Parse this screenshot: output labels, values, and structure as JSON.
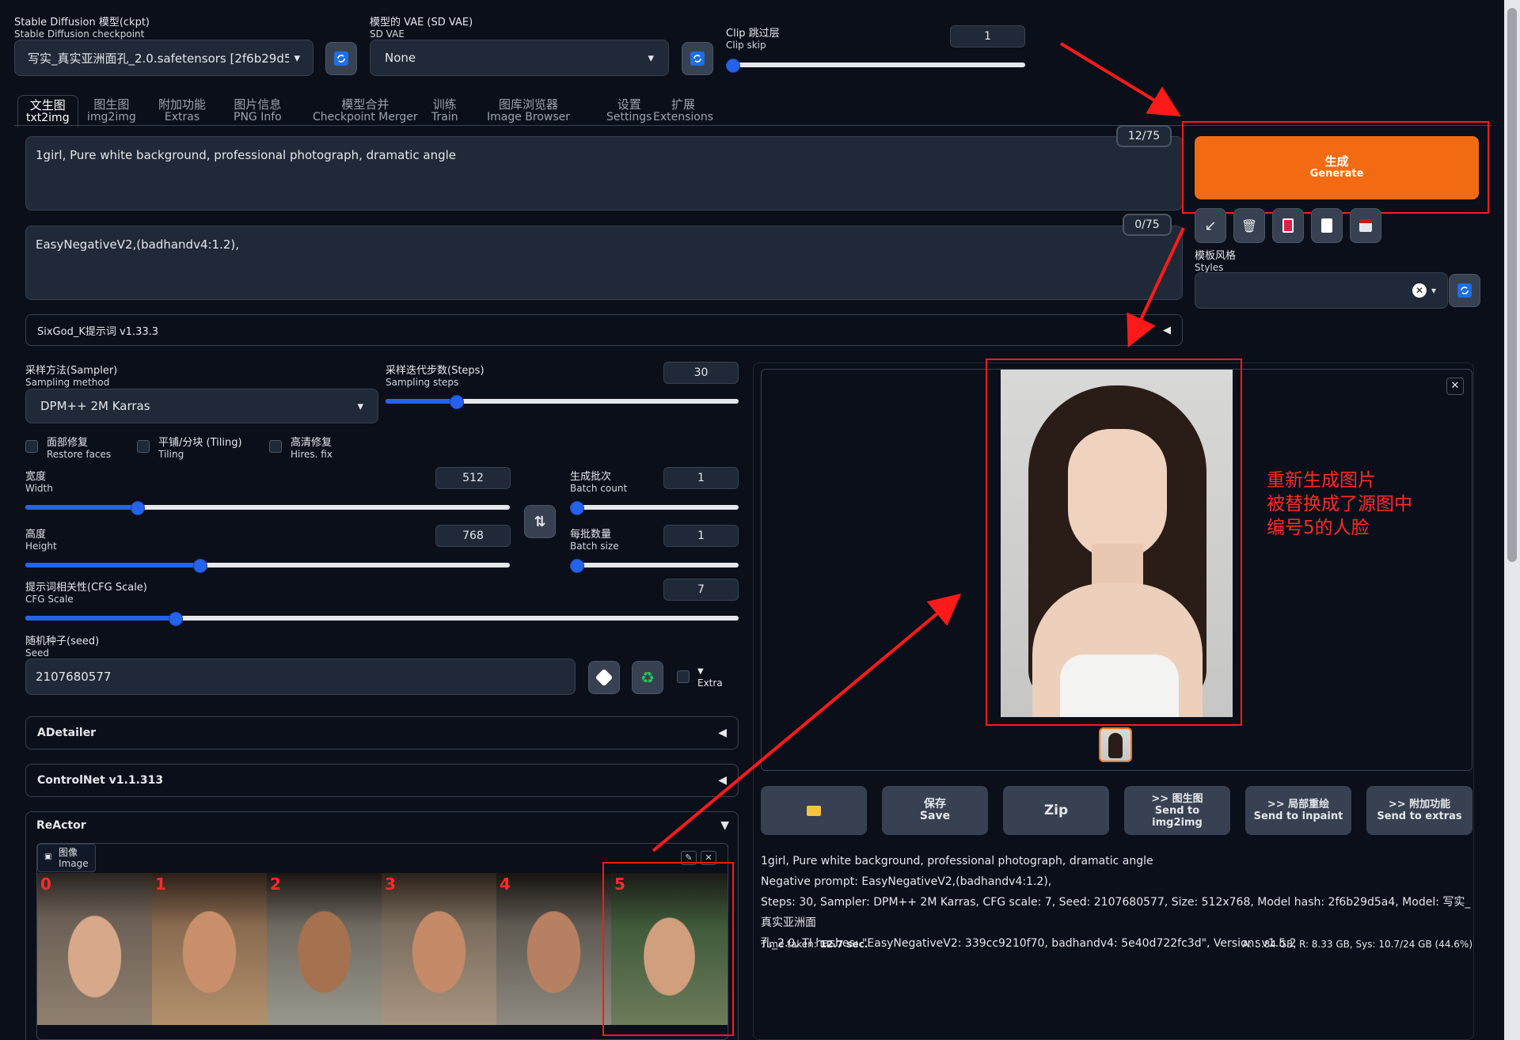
{
  "top": {
    "ckpt_label_cn": "Stable Diffusion 模型(ckpt)",
    "ckpt_label_en": "Stable Diffusion checkpoint",
    "ckpt_value": "写实_真实亚洲面孔_2.0.safetensors [2f6b29d5",
    "vae_label_cn": "模型的 VAE (SD VAE)",
    "vae_label_en": "SD VAE",
    "vae_value": "None",
    "clip_label_cn": "Clip 跳过层",
    "clip_label_en": "Clip skip",
    "clip_value": "1",
    "clip_level": 0.0
  },
  "tabs": [
    {
      "cn": "文生图",
      "en": "txt2img"
    },
    {
      "cn": "图生图",
      "en": "img2img"
    },
    {
      "cn": "附加功能",
      "en": "Extras"
    },
    {
      "cn": "图片信息",
      "en": "PNG Info"
    },
    {
      "cn": "模型合并",
      "en": "Checkpoint Merger"
    },
    {
      "cn": "训练",
      "en": "Train"
    },
    {
      "cn": "图库浏览器",
      "en": "Image Browser"
    },
    {
      "cn": "设置",
      "en": "Settings"
    },
    {
      "cn": "扩展",
      "en": "Extensions"
    }
  ],
  "prompt": {
    "positive": "1girl, Pure white background, professional photograph, dramatic angle",
    "positive_count": "12/75",
    "negative": "EasyNegativeV2,(badhandv4:1.2),",
    "negative_count": "0/75"
  },
  "generate": {
    "cn": "生成",
    "en": "Generate"
  },
  "styles": {
    "label_cn": "模板风格",
    "label_en": "Styles"
  },
  "sixgod": "SixGod_K提示词 v1.33.3",
  "sampler": {
    "label_cn": "采样方法(Sampler)",
    "label_en": "Sampling method",
    "value": "DPM++ 2M Karras",
    "steps_label_cn": "采样迭代步数(Steps)",
    "steps_label_en": "Sampling steps",
    "steps": "30",
    "steps_level": 0.2
  },
  "checks": [
    {
      "cn": "面部修复",
      "en": "Restore faces"
    },
    {
      "cn": "平铺/分块 (Tiling)",
      "en": "Tiling"
    },
    {
      "cn": "高清修复",
      "en": "Hires. fix"
    }
  ],
  "dims": {
    "width_cn": "宽度",
    "width_en": "Width",
    "width": "512",
    "width_level": 0.23,
    "height_cn": "高度",
    "height_en": "Height",
    "height": "768",
    "height_level": 0.36,
    "batch_count_cn": "生成批次",
    "batch_count_en": "Batch count",
    "batch_count": "1",
    "batch_count_level": 0.0,
    "batch_size_cn": "每批数量",
    "batch_size_en": "Batch size",
    "batch_size": "1",
    "batch_size_level": 0.0,
    "cfg_cn": "提示词相关性(CFG Scale)",
    "cfg_en": "CFG Scale",
    "cfg": "7",
    "cfg_level": 0.21
  },
  "seed": {
    "label_cn": "随机种子(seed)",
    "label_en": "Seed",
    "value": "2107680577",
    "extra": "Extra"
  },
  "accordions": {
    "adetailer": "ADetailer",
    "controlnet": "ControlNet v1.1.313",
    "reactor": "ReActor"
  },
  "reactor": {
    "image_cn": "图像",
    "image_en": "Image",
    "face_numbers": [
      "0",
      "1",
      "2",
      "3",
      "4",
      "5"
    ]
  },
  "annotation": {
    "line1": "重新生成图片",
    "line2": "被替换成了源图中",
    "line3": "编号5的人脸"
  },
  "actions": [
    {
      "cn": "",
      "en": "",
      "icon": "folder-icon"
    },
    {
      "cn": "保存",
      "en": "Save"
    },
    {
      "cn": "Zip",
      "en": ""
    },
    {
      "cn": ">> 图生图",
      "en": "Send to img2img"
    },
    {
      "cn": ">> 局部重绘",
      "en": "Send to inpaint"
    },
    {
      "cn": ">> 附加功能",
      "en": "Send to extras"
    }
  ],
  "info": {
    "line1": "1girl, Pure white background, professional photograph, dramatic angle",
    "line2": "Negative prompt: EasyNegativeV2,(badhandv4:1.2),",
    "line3": "Steps: 30, Sampler: DPM++ 2M Karras, CFG scale: 7, Seed: 2107680577, Size: 512x768, Model hash: 2f6b29d5a4, Model: 写实_真实亚洲面",
    "line4": "孔_2.0, TI hashes: \"EasyNegativeV2: 339cc9210f70, badhandv4: 5e40d722fc3d\", Version: v1.5.2",
    "time_label": "Time taken:",
    "time_value": "12.7 sec.",
    "vram": "A: 5.84 GB, R: 8.33 GB, Sys: 10.7/24 GB (44.6%)"
  },
  "colors": {
    "accent": "#2563eb",
    "generate": "#f26b12",
    "annotation": "#ff2a2a"
  }
}
